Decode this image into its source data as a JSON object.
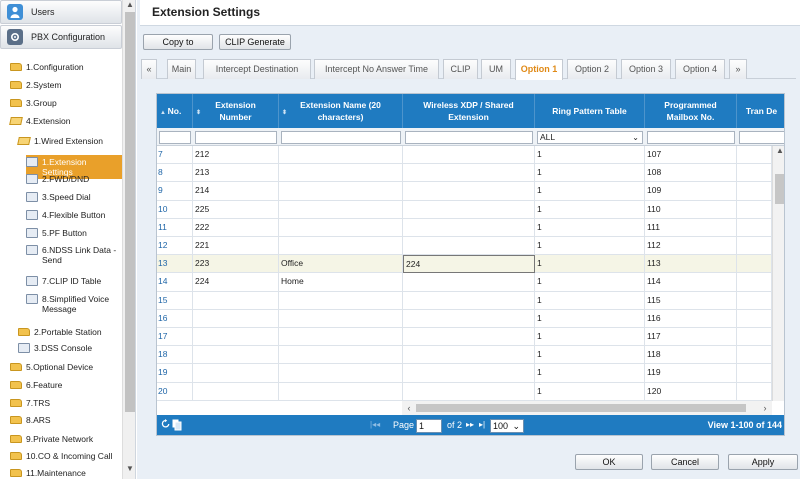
{
  "sidebar": {
    "users_label": "Users",
    "pbx_label": "PBX Configuration",
    "tree": [
      {
        "label": "1.Configuration",
        "indent": 0,
        "icon": "folder"
      },
      {
        "label": "2.System",
        "indent": 0,
        "icon": "folder"
      },
      {
        "label": "3.Group",
        "indent": 0,
        "icon": "folder"
      },
      {
        "label": "4.Extension",
        "indent": 0,
        "icon": "folder-open"
      },
      {
        "label": "1.Wired Extension",
        "indent": 1,
        "icon": "folder-open"
      },
      {
        "label": "1.Extension Settings",
        "indent": 2,
        "icon": "phone-icon",
        "selected": true
      },
      {
        "label": "2.FWD/DND",
        "indent": 2,
        "icon": "fwd-dnd-icon"
      },
      {
        "label": "3.Speed Dial",
        "indent": 2,
        "icon": "speed-dial-icon"
      },
      {
        "label": "4.Flexible Button",
        "indent": 2,
        "icon": "flexible-button-icon"
      },
      {
        "label": "5.PF Button",
        "indent": 2,
        "icon": "pf-button-icon"
      },
      {
        "label": "6.NDSS Link Data - Send",
        "indent": 2,
        "icon": "ndss-icon"
      },
      {
        "label": "7.CLIP ID Table",
        "indent": 2,
        "icon": "clip-table-icon"
      },
      {
        "label": "8.Simplified Voice Message",
        "indent": 2,
        "icon": "voice-message-icon"
      },
      {
        "label": "2.Portable Station",
        "indent": 1,
        "icon": "folder"
      },
      {
        "label": "3.DSS Console",
        "indent": 1,
        "icon": "dss-console-icon"
      },
      {
        "label": "5.Optional Device",
        "indent": 0,
        "icon": "folder"
      },
      {
        "label": "6.Feature",
        "indent": 0,
        "icon": "folder"
      },
      {
        "label": "7.TRS",
        "indent": 0,
        "icon": "folder"
      },
      {
        "label": "8.ARS",
        "indent": 0,
        "icon": "folder"
      },
      {
        "label": "9.Private Network",
        "indent": 0,
        "icon": "folder"
      },
      {
        "label": "10.CO & Incoming Call",
        "indent": 0,
        "icon": "folder"
      },
      {
        "label": "11.Maintenance",
        "indent": 0,
        "icon": "folder"
      }
    ]
  },
  "page": {
    "title": "Extension Settings",
    "copy_to": "Copy to",
    "clip_generate": "CLIP Generate"
  },
  "tabs": [
    {
      "label": "«"
    },
    {
      "label": "Main"
    },
    {
      "label": "Intercept Destination"
    },
    {
      "label": "Intercept No Answer Time"
    },
    {
      "label": "CLIP"
    },
    {
      "label": "UM"
    },
    {
      "label": "Option 1",
      "active": true
    },
    {
      "label": "Option 2"
    },
    {
      "label": "Option 3"
    },
    {
      "label": "Option 4"
    },
    {
      "label": "»"
    }
  ],
  "grid": {
    "headers": [
      {
        "label": "No.",
        "sort": "▲"
      },
      {
        "label": "Extension Number",
        "sort": "⬍"
      },
      {
        "label": "Extension Name (20 characters)",
        "sort": "⬍"
      },
      {
        "label": "Wireless XDP / Shared Extension",
        "sort": ""
      },
      {
        "label": "Ring Pattern Table",
        "sort": ""
      },
      {
        "label": "Programmed Mailbox No.",
        "sort": ""
      },
      {
        "label": "Tran De",
        "sort": ""
      }
    ],
    "filter_ring": "ALL",
    "rows": [
      {
        "no": "7",
        "ext": "212",
        "name": "",
        "wireless": "",
        "ring": "1",
        "mailbox": "107"
      },
      {
        "no": "8",
        "ext": "213",
        "name": "",
        "wireless": "",
        "ring": "1",
        "mailbox": "108"
      },
      {
        "no": "9",
        "ext": "214",
        "name": "",
        "wireless": "",
        "ring": "1",
        "mailbox": "109"
      },
      {
        "no": "10",
        "ext": "225",
        "name": "",
        "wireless": "",
        "ring": "1",
        "mailbox": "110"
      },
      {
        "no": "11",
        "ext": "222",
        "name": "",
        "wireless": "",
        "ring": "1",
        "mailbox": "111"
      },
      {
        "no": "12",
        "ext": "221",
        "name": "",
        "wireless": "",
        "ring": "1",
        "mailbox": "112"
      },
      {
        "no": "13",
        "ext": "223",
        "name": "Office",
        "wireless": "224",
        "ring": "1",
        "mailbox": "113",
        "highlight": true
      },
      {
        "no": "14",
        "ext": "224",
        "name": "Home",
        "wireless": "",
        "ring": "1",
        "mailbox": "114"
      },
      {
        "no": "15",
        "ext": "",
        "name": "",
        "wireless": "",
        "ring": "1",
        "mailbox": "115"
      },
      {
        "no": "16",
        "ext": "",
        "name": "",
        "wireless": "",
        "ring": "1",
        "mailbox": "116"
      },
      {
        "no": "17",
        "ext": "",
        "name": "",
        "wireless": "",
        "ring": "1",
        "mailbox": "117"
      },
      {
        "no": "18",
        "ext": "",
        "name": "",
        "wireless": "",
        "ring": "1",
        "mailbox": "118"
      },
      {
        "no": "19",
        "ext": "",
        "name": "",
        "wireless": "",
        "ring": "1",
        "mailbox": "119"
      },
      {
        "no": "20",
        "ext": "",
        "name": "",
        "wireless": "",
        "ring": "1",
        "mailbox": "120"
      }
    ]
  },
  "pager": {
    "page_label": "Page",
    "page_value": "1",
    "of_label": "of 2",
    "page_size": "100",
    "view_text": "View 1-100 of 144"
  },
  "footer": {
    "ok": "OK",
    "cancel": "Cancel",
    "apply": "Apply"
  },
  "colors": {
    "accent": "#e9a02a",
    "grid_header": "#1f7bc1",
    "active_tab": "#e08a17"
  }
}
